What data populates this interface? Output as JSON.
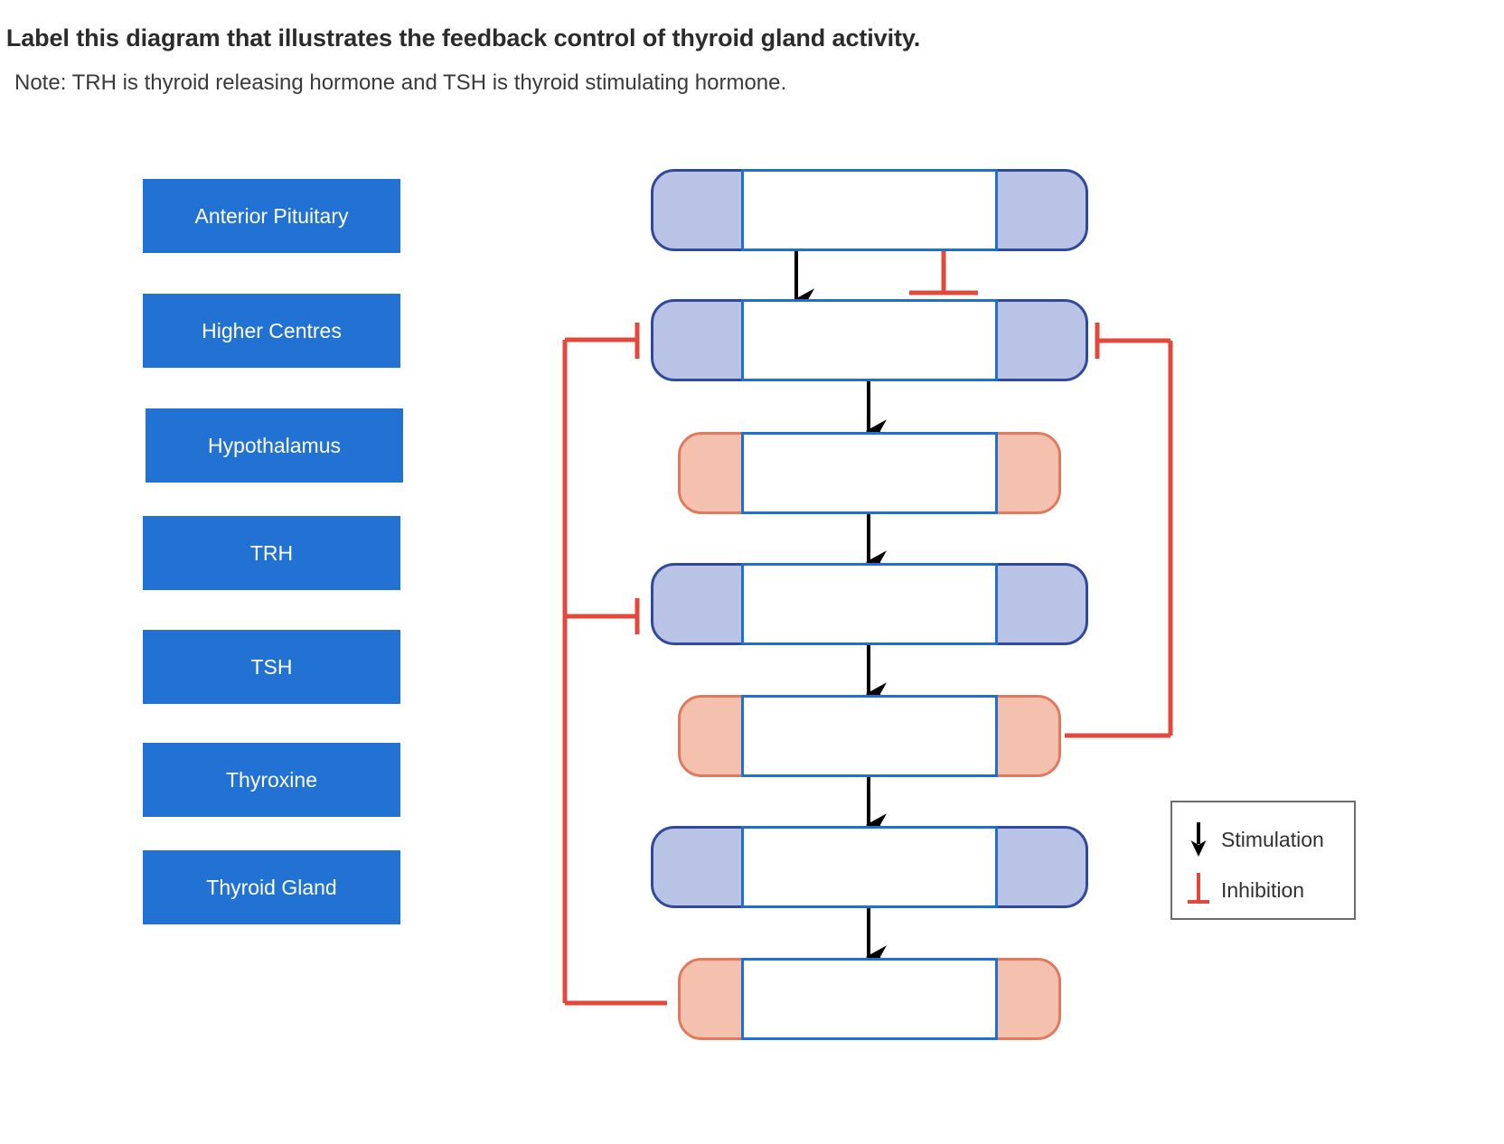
{
  "header": {
    "number_prefix": ".",
    "title": "Label this diagram that illustrates the feedback control of thyroid gland activity.",
    "note": "Note: TRH is thyroid releasing hormone and TSH is thyroid stimulating hormone."
  },
  "answer_bank": {
    "name": "draggable-label-bank",
    "chips": [
      {
        "id": "anterior-pituitary",
        "label": "Anterior Pituitary"
      },
      {
        "id": "higher-centres",
        "label": "Higher Centres"
      },
      {
        "id": "hypothalamus",
        "label": "Hypothalamus"
      },
      {
        "id": "trh",
        "label": "TRH"
      },
      {
        "id": "tsh",
        "label": "TSH"
      },
      {
        "id": "thyroxine",
        "label": "Thyroxine"
      },
      {
        "id": "thyroid-gland",
        "label": "Thyroid Gland"
      }
    ]
  },
  "diagram": {
    "nodes": [
      {
        "id": "node-1",
        "style": "blue",
        "dropzone_value": ""
      },
      {
        "id": "node-2",
        "style": "blue",
        "dropzone_value": ""
      },
      {
        "id": "node-3",
        "style": "peach",
        "dropzone_value": ""
      },
      {
        "id": "node-4",
        "style": "blue",
        "dropzone_value": ""
      },
      {
        "id": "node-5",
        "style": "peach",
        "dropzone_value": ""
      },
      {
        "id": "node-6",
        "style": "blue",
        "dropzone_value": ""
      },
      {
        "id": "node-7",
        "style": "peach",
        "dropzone_value": ""
      }
    ],
    "connector_counts": {
      "stimulation_arrows": 6,
      "inhibition_links": 4
    }
  },
  "legend": {
    "stimulation_label": "Stimulation",
    "inhibition_label": "Inhibition"
  },
  "colors": {
    "chip_blue": "#2272d3",
    "node_blue_fill": "#b8c3e6",
    "node_blue_border": "#31499b",
    "node_peach_fill": "#f3c1ae",
    "node_peach_border": "#e07a5f",
    "dropzone_border": "#1f6fd0",
    "stimulation_black": "#000000",
    "inhibition_red": "#e2483c",
    "text_dark": "#2b2b2b"
  }
}
